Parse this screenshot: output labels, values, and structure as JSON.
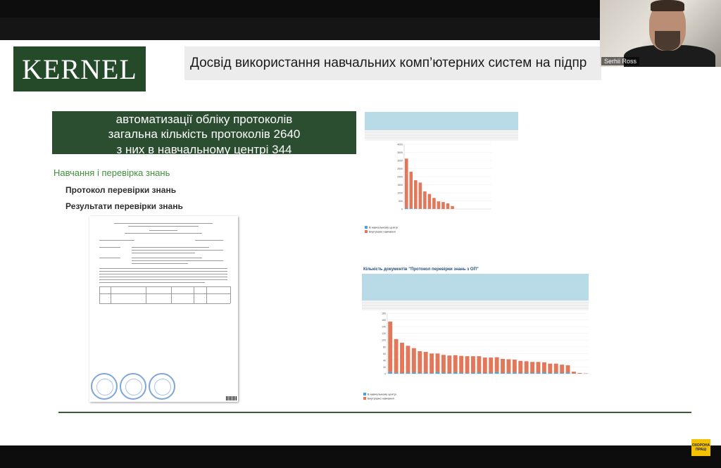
{
  "slide": {
    "logo_text": "KERNEL",
    "title": "Досвід використання навчальних комп’ютерних систем на підпр",
    "green_box_lines": [
      "автоматизації  обліку протоколів",
      "загальна кількість протоколів 2640",
      "з них в навчальному центрі 344"
    ],
    "section_title": "Навчання і перевірка знань",
    "items": [
      "Протокол перевірки знань",
      "Результати перевірки знань"
    ]
  },
  "video": {
    "participant_name": "Serhii Ross"
  },
  "badge": {
    "text": "ОХОРОНА ПРАЦІ"
  },
  "colors": {
    "kernel_green": "#244a2a",
    "box_green": "#2b4d30",
    "section_green": "#3f8f3b",
    "bar_blue": "#4aa3df",
    "bar_orange": "#e2775a"
  },
  "chart_data": [
    {
      "type": "bar",
      "stacked": true,
      "title": "",
      "ylim": [
        0,
        4000
      ],
      "yticks": [
        0,
        500,
        1000,
        1500,
        2000,
        2500,
        3000,
        3500,
        4000
      ],
      "categories": [
        "",
        "",
        "",
        "",
        "",
        "",
        "",
        "",
        "",
        "",
        "",
        "",
        "",
        "",
        "",
        "",
        "",
        "",
        ""
      ],
      "series": [
        {
          "name": "В навчальному центрі",
          "values": [
            64,
            36,
            30,
            16,
            10,
            9,
            13,
            2,
            0,
            4,
            0,
            0,
            0,
            0,
            0,
            0,
            0,
            0,
            0
          ]
        },
        {
          "name": "Внутрішнє навчання",
          "values": [
            3050,
            2270,
            1750,
            1620,
            1080,
            920,
            670,
            470,
            430,
            340,
            180,
            0,
            0,
            0,
            0,
            0,
            0,
            0,
            0
          ]
        }
      ]
    },
    {
      "type": "bar",
      "stacked": true,
      "title": "Кількість документів \"Протокол перевірки знань з ОП\"",
      "ylim": [
        0,
        180
      ],
      "yticks": [
        0,
        20,
        40,
        60,
        80,
        100,
        120,
        140,
        160,
        180
      ],
      "categories": [
        "",
        "",
        "",
        "",
        "",
        "",
        "",
        "",
        "",
        "",
        "",
        "",
        "",
        "",
        "",
        "",
        "",
        "",
        "",
        "",
        "",
        "",
        "",
        "",
        "",
        "",
        "",
        "",
        "",
        "",
        "",
        "",
        "",
        ""
      ],
      "series": [
        {
          "name": "В навчальному центрі",
          "values": [
            5,
            3,
            2,
            3,
            4,
            2,
            3,
            2,
            5,
            3,
            2,
            4,
            3,
            2,
            3,
            4,
            2,
            3,
            5,
            2,
            3,
            4,
            2,
            3,
            2,
            3,
            4,
            2,
            3,
            2,
            3,
            0,
            0,
            0
          ]
        },
        {
          "name": "Внутрішнє навчання",
          "values": [
            150,
            100,
            90,
            80,
            72,
            65,
            62,
            58,
            55,
            53,
            52,
            51,
            50,
            50,
            49,
            48,
            46,
            45,
            44,
            42,
            40,
            38,
            36,
            34,
            33,
            32,
            30,
            28,
            27,
            25,
            22,
            6,
            2,
            1
          ]
        }
      ]
    }
  ]
}
